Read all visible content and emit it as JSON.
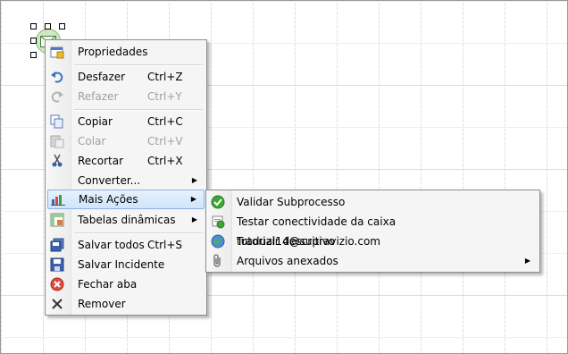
{
  "context_menu": {
    "items": [
      {
        "label": "Propriedades",
        "shortcut": "",
        "icon": "properties-icon",
        "disabled": false
      },
      {
        "label": "Desfazer",
        "shortcut": "Ctrl+Z",
        "icon": "undo-icon",
        "disabled": false
      },
      {
        "label": "Refazer",
        "shortcut": "Ctrl+Y",
        "icon": "redo-icon",
        "disabled": true
      },
      {
        "label": "Copiar",
        "shortcut": "Ctrl+C",
        "icon": "copy-icon",
        "disabled": false
      },
      {
        "label": "Colar",
        "shortcut": "Ctrl+V",
        "icon": "paste-icon",
        "disabled": true
      },
      {
        "label": "Recortar",
        "shortcut": "Ctrl+X",
        "icon": "cut-icon",
        "disabled": false
      },
      {
        "label": "Converter...",
        "shortcut": "",
        "icon": "",
        "disabled": false,
        "submenu": true
      },
      {
        "label": "Mais Ações",
        "shortcut": "",
        "icon": "more-actions-icon",
        "disabled": false,
        "submenu": true,
        "highlighted": true
      },
      {
        "label": "Tabelas dinâmicas",
        "shortcut": "",
        "icon": "pivot-table-icon",
        "disabled": false,
        "submenu": true
      },
      {
        "label": "Salvar todos",
        "shortcut": "Ctrl+S",
        "icon": "save-all-icon",
        "disabled": false
      },
      {
        "label": "Salvar Incidente",
        "shortcut": "",
        "icon": "save-icon",
        "disabled": false
      },
      {
        "label": "Fechar aba",
        "shortcut": "",
        "icon": "close-tab-icon",
        "disabled": false
      },
      {
        "label": "Remover",
        "shortcut": "",
        "icon": "remove-icon",
        "disabled": false
      }
    ]
  },
  "submenu": {
    "items": [
      {
        "label": "Validar Subprocesso",
        "icon": "check-icon"
      },
      {
        "label": "Testar conectividade da caixa tutorial14@supravizio.com",
        "icon": "connectivity-icon"
      },
      {
        "label": "Traduzir descritivo",
        "icon": "globe-icon"
      },
      {
        "label": "Arquivos anexados",
        "icon": "paperclip-icon",
        "submenu": true
      }
    ]
  },
  "colors": {
    "highlight": "#d0e5fb",
    "highlight_border": "#8db2e3",
    "node_fill": "#cfe8c4"
  }
}
